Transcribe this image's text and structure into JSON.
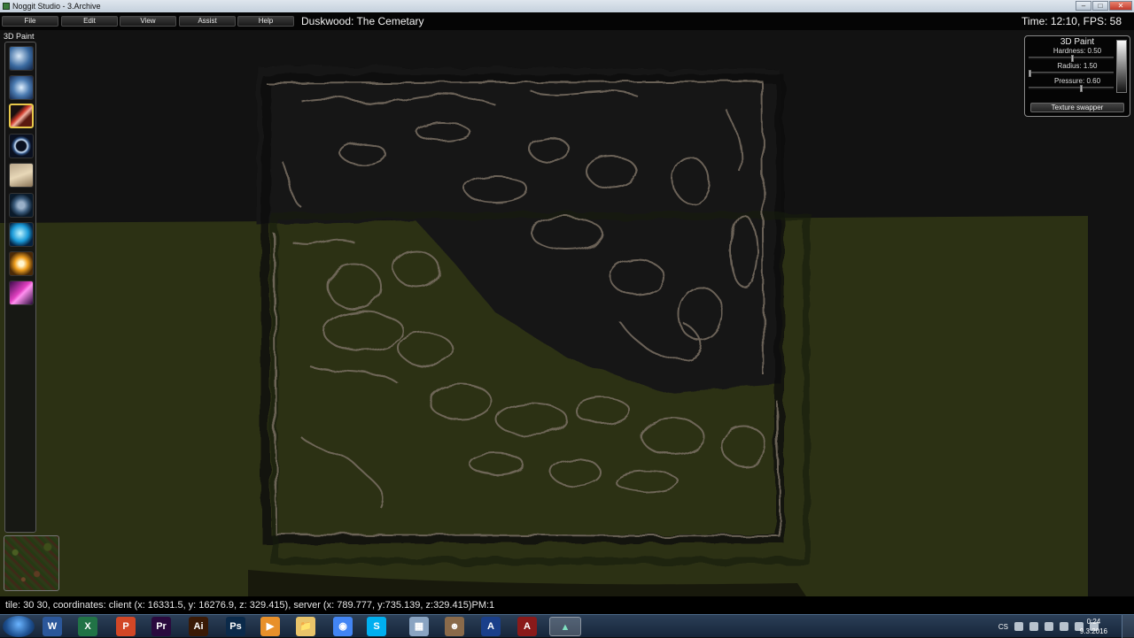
{
  "window": {
    "title": "Noggit Studio - 3.Archive",
    "buttons": {
      "minimize": "–",
      "maximize": "□",
      "close": "✕"
    }
  },
  "menu": {
    "items": [
      "File",
      "Edit",
      "View",
      "Assist",
      "Help"
    ]
  },
  "header": {
    "map_title": "Duskwood: The Cemetary",
    "time_fps": "Time: 12:10, FPS: 58"
  },
  "tools": {
    "label": "3D Paint",
    "items": [
      {
        "name": "raise-lower",
        "icon": "sphere-icon"
      },
      {
        "name": "flatten-blur",
        "icon": "wind-icon"
      },
      {
        "name": "3d-paint",
        "icon": "brush-icon",
        "active": true
      },
      {
        "name": "holes",
        "icon": "ring-icon"
      },
      {
        "name": "area-id",
        "icon": "scroll-icon"
      },
      {
        "name": "impassible",
        "icon": "cross-icon"
      },
      {
        "name": "water",
        "icon": "water-icon"
      },
      {
        "name": "object",
        "icon": "sun-icon"
      },
      {
        "name": "mccv",
        "icon": "lightning-icon"
      }
    ]
  },
  "paint_panel": {
    "title": "3D Paint",
    "hardness": {
      "label": "Hardness: 0.50",
      "value": 0.5
    },
    "radius": {
      "label": "Radius: 1.50",
      "value": 0.0
    },
    "pressure": {
      "label": "Pressure: 0.60",
      "value": 0.6
    },
    "texture_swapper": "Texture swapper"
  },
  "status": {
    "text": "tile: 30 30, coordinates: client (x: 16331.5, y: 16276.9, z: 329.415), server (x: 789.777, y:735.139, z:329.415)PM:1"
  },
  "taskbar": {
    "apps": [
      {
        "name": "word",
        "letter": "W",
        "color": "#2b579a"
      },
      {
        "name": "excel",
        "letter": "X",
        "color": "#217346"
      },
      {
        "name": "powerpoint",
        "letter": "P",
        "color": "#d24726"
      },
      {
        "name": "premiere",
        "letter": "Pr",
        "color": "#2a0a3e"
      },
      {
        "name": "illustrator",
        "letter": "Ai",
        "color": "#3a1a06"
      },
      {
        "name": "photoshop",
        "letter": "Ps",
        "color": "#0b2a4a"
      },
      {
        "name": "media-player",
        "letter": "▶",
        "color": "#e8902a"
      },
      {
        "name": "explorer",
        "letter": "📁",
        "color": "#e9c46a"
      },
      {
        "name": "chrome",
        "letter": "◉",
        "color": "#4285f4"
      },
      {
        "name": "skype",
        "letter": "S",
        "color": "#00aff0"
      },
      {
        "name": "calculator",
        "letter": "▦",
        "color": "#8aa4c2"
      },
      {
        "name": "game-character",
        "letter": "☻",
        "color": "#8a6a4a"
      },
      {
        "name": "app-a-blue",
        "letter": "A",
        "color": "#1a3f8a"
      },
      {
        "name": "app-a-red",
        "letter": "A",
        "color": "#8a1a1a"
      },
      {
        "name": "noggit",
        "letter": "▲",
        "color": "#1c5a4a",
        "active": true
      }
    ],
    "language": "CS",
    "clock_time": "0:24",
    "clock_date": "9.3.2016"
  }
}
